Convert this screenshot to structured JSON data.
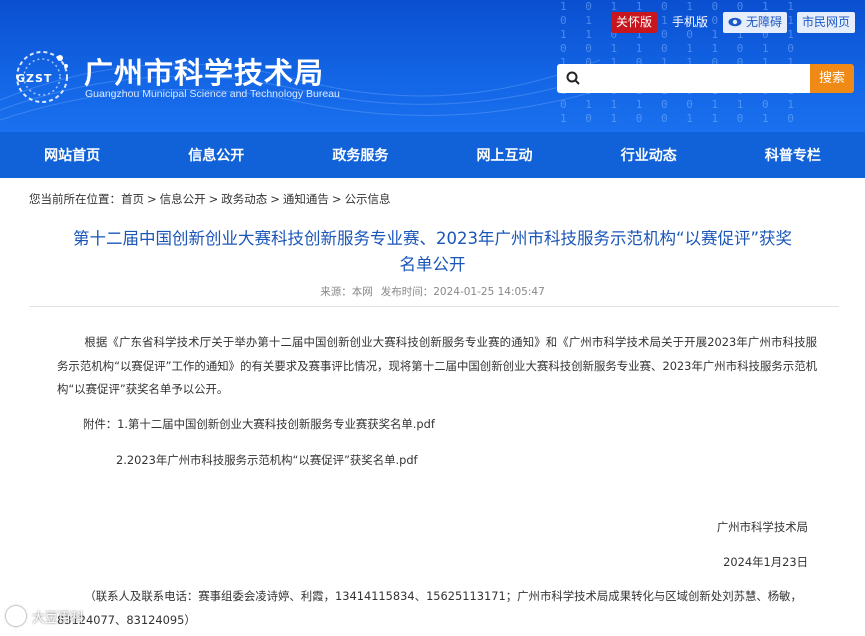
{
  "header": {
    "logo_mark_text": "GZST",
    "site_title": "广州市科学技术局",
    "site_subtitle": "Guangzhou Municipal Science and Technology Bureau",
    "top_links": {
      "care": "关怀版",
      "mobile": "手机版",
      "accessibility": "无障碍",
      "citizen": "市民网页"
    },
    "search": {
      "placeholder": "",
      "button_label": "搜索"
    },
    "colors": {
      "header_bg": "#0a4fd0",
      "nav_bg": "#1162d8",
      "care_badge": "#c8161e",
      "search_button": "#ef8a17",
      "title_text": "#1a56b8"
    }
  },
  "nav": {
    "items": [
      "网站首页",
      "信息公开",
      "政务服务",
      "网上互动",
      "行业动态",
      "科普专栏"
    ]
  },
  "breadcrumb": {
    "prefix": "您当前所在位置：",
    "items": [
      "首页",
      "信息公开",
      "政务动态",
      "通知通告",
      "公示信息"
    ],
    "separator": ">"
  },
  "article": {
    "title_line1": "第十二届中国创新创业大赛科技创新服务专业赛、2023年广州市科技服务示范机构“以赛促评”获奖",
    "title_line2": "名单公开",
    "source_label": "来源：本网",
    "publish_label": "发布时间：",
    "publish_time": "2024-01-25 14:05:47",
    "body": "根据《广东省科学技术厅关于举办第十二届中国创新创业大赛科技创新服务专业赛的通知》和《广州市科学技术局关于开展2023年广州市科技服务示范机构“以赛促评”工作的通知》的有关要求及赛事评比情况，现将第十二届中国创新创业大赛科技创新服务专业赛、2023年广州市科技服务示范机构“以赛促评”获奖名单予以公开。",
    "attachment_1": "附件：1.第十二届中国创新创业大赛科技创新服务专业赛获奖名单.pdf",
    "attachment_2": "2.2023年广州市科技服务示范机构“以赛促评”获奖名单.pdf",
    "sign_org": "广州市科学技术局",
    "sign_date": "2024年1月23日",
    "contact": "（联系人及联系电话：赛事组委会凌诗婷、利霞，13414115834、15625113171；广州市科学技术局成果转化与区域创新处刘苏慧、杨敏，83124077、83124095）"
  },
  "watermark": {
    "icon": "camera-watermark-icon",
    "text": "大豆百科"
  },
  "icons": {
    "search": "search-icon",
    "eye": "eye-icon",
    "logo": "gzst-logo-icon"
  }
}
